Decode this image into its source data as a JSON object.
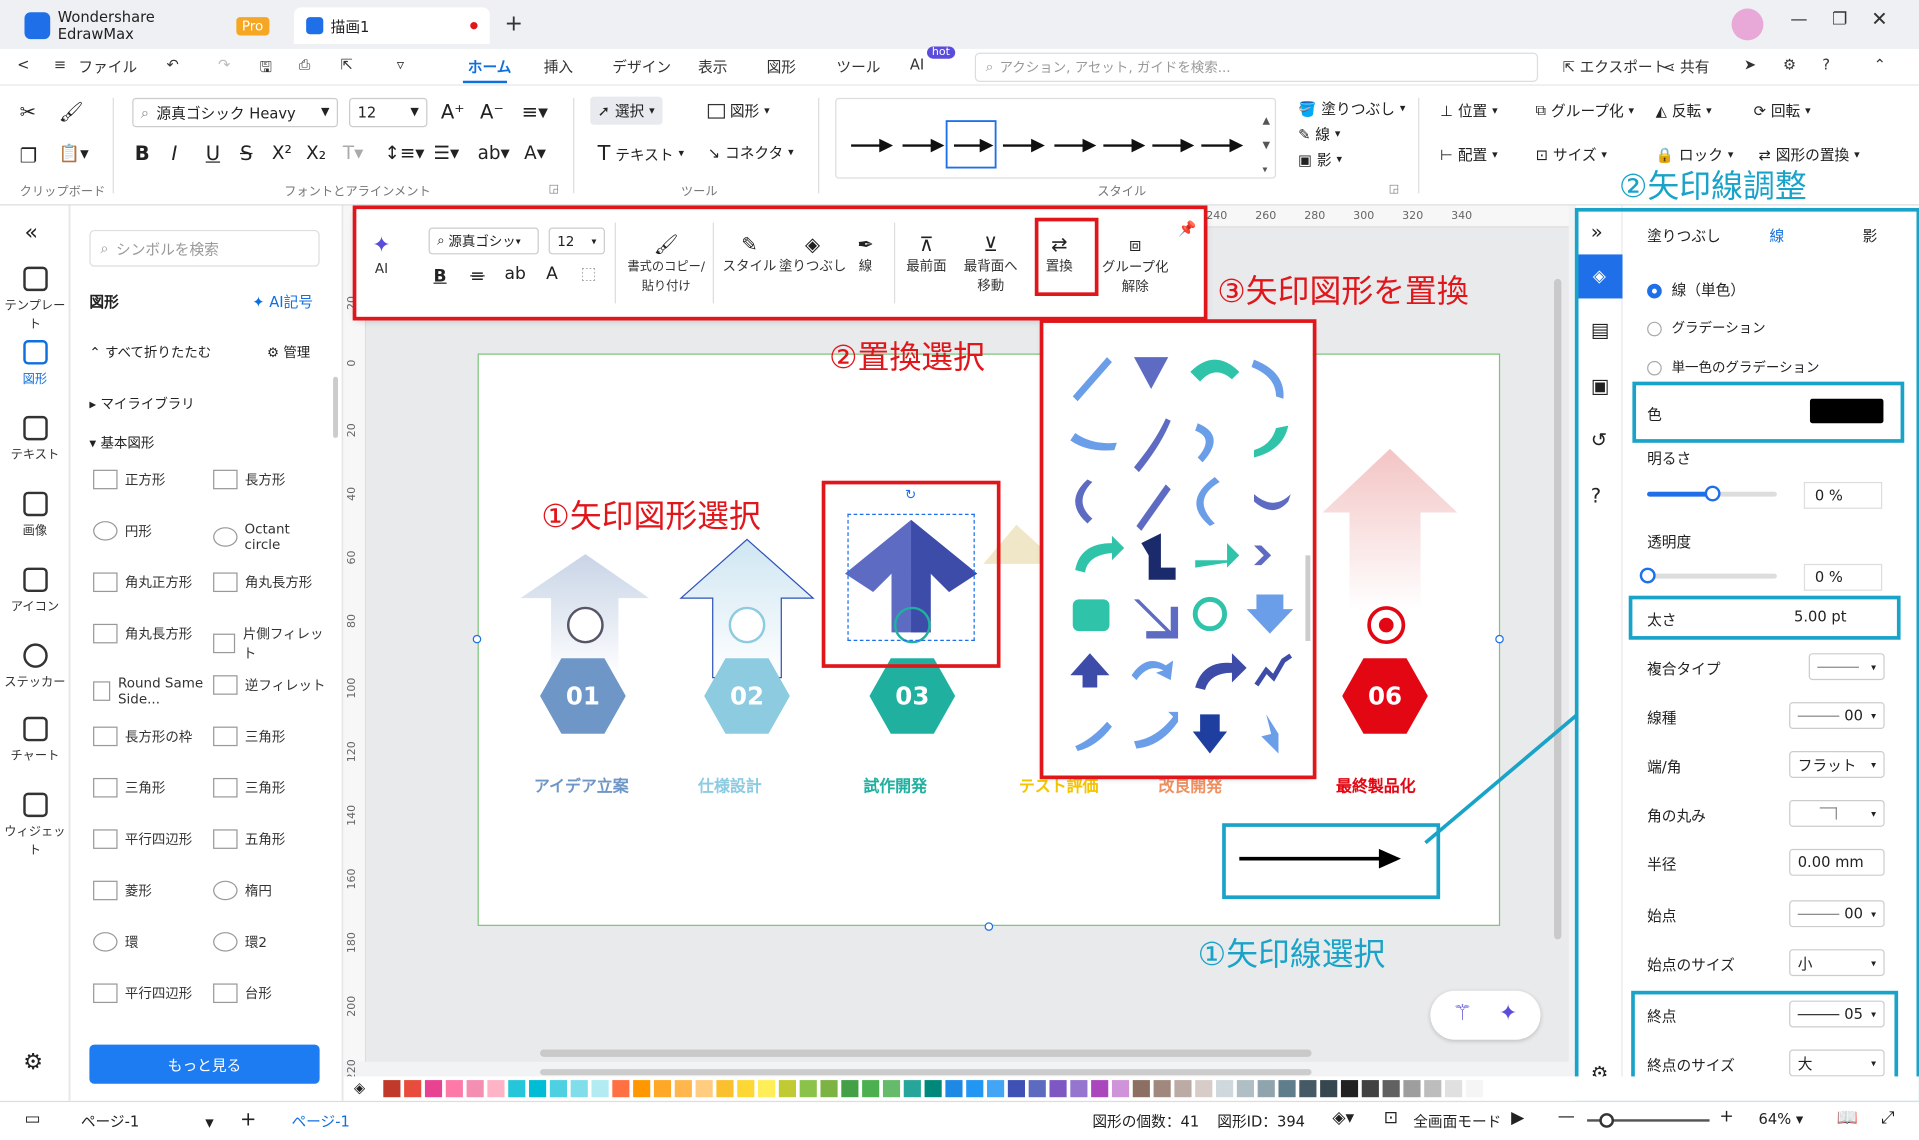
{
  "app": {
    "title": "Wondershare EdrawMax",
    "badge": "Pro",
    "doc_tab": "描画1"
  },
  "menubar": {
    "file": "ファイル",
    "tabs": [
      "ホーム",
      "挿入",
      "デザイン",
      "表示",
      "図形",
      "ツール",
      "AI"
    ],
    "ai_badge": "hot",
    "search_placeholder": "アクション, アセット, ガイドを検索...",
    "export": "エクスポート",
    "share": "共有"
  },
  "ribbon": {
    "font_name": "源真ゴシック Heavy",
    "font_size": "12",
    "select": "選択",
    "shape": "図形",
    "text": "テキスト",
    "connector": "コネクタ",
    "fill": "塗りつぶし",
    "line": "線",
    "shadow": "影",
    "position": "位置",
    "group": "グループ化",
    "flip": "反転",
    "rotate": "回転",
    "align": "配置",
    "size": "サイズ",
    "lock": "ロック",
    "replace_shape": "図形の置換",
    "groups": {
      "clipboard": "クリップボード",
      "font": "フォントとアラインメント",
      "tools": "ツール",
      "style": "スタイル"
    }
  },
  "leftrail": [
    "テンプレート",
    "図形",
    "テキスト",
    "画像",
    "アイコン",
    "ステッカー",
    "チャート",
    "ウィジェット"
  ],
  "library": {
    "search_placeholder": "シンボルを検索",
    "header": "図形",
    "ai_label": "AI記号",
    "collapse_all": "すべて折りたたむ",
    "manage": "管理",
    "my_library": "マイライブラリ",
    "basic_shapes": "基本図形",
    "shapes": [
      [
        "正方形",
        "長方形"
      ],
      [
        "円形",
        "Octant circle"
      ],
      [
        "角丸正方形",
        "角丸長方形"
      ],
      [
        "角丸長方形",
        "片側フィレット"
      ],
      [
        "Round Same Side...",
        "逆フィレット"
      ],
      [
        "長方形の枠",
        "三角形"
      ],
      [
        "三角形",
        "三角形"
      ],
      [
        "平行四辺形",
        "五角形"
      ],
      [
        "菱形",
        "楕円"
      ],
      [
        "環",
        "環2"
      ],
      [
        "平行四辺形",
        "台形"
      ]
    ],
    "more_button": "もっと見る"
  },
  "floating_toolbar": {
    "ai": "AI",
    "font": "源真ゴシッ",
    "size": "12",
    "format_copy": "書式のコピー/貼り付け",
    "style": "スタイル",
    "fill": "塗りつぶし",
    "line": "線",
    "front": "最前面",
    "back": "最背面へ移動",
    "replace": "置換",
    "ungroup": "グループ化解除"
  },
  "ruler": [
    "240",
    "260",
    "280",
    "300",
    "320",
    "340"
  ],
  "vruler": [
    "20",
    "0",
    "20",
    "40",
    "60",
    "80",
    "100",
    "120",
    "140",
    "160",
    "180",
    "200",
    "220"
  ],
  "steps": [
    {
      "num": "01",
      "label": "アイデア立案",
      "color": "#6e96c6",
      "labelcolor": "#6e96c6"
    },
    {
      "num": "02",
      "label": "仕様設計",
      "color": "#8ccbe0",
      "labelcolor": "#8ccbe0"
    },
    {
      "num": "03",
      "label": "試作開発",
      "color": "#1fb0a0",
      "labelcolor": "#1fb0a0"
    },
    {
      "num": "",
      "label": "テスト評価",
      "color": "#f5c400",
      "labelcolor": "#f5c400"
    },
    {
      "num": "",
      "label": "改良開発",
      "color": "#f09060",
      "labelcolor": "#f09060"
    },
    {
      "num": "06",
      "label": "最終製品化",
      "color": "#e30613",
      "labelcolor": "#e30613"
    }
  ],
  "annotations": {
    "red1": "①矢印図形選択",
    "red2": "②置換選択",
    "red3": "③矢印図形を置換",
    "blue1": "①矢印線選択",
    "blue2": "②矢印線調整"
  },
  "rightpanel": {
    "tabs": [
      "塗りつぶし",
      "線",
      "影"
    ],
    "line_options": [
      "線（単色）",
      "グラデーション",
      "単一色のグラデーション"
    ],
    "color_label": "色",
    "brightness": "明るさ",
    "brightness_val": "0 %",
    "brightness_level": 0.5,
    "transparency": "透明度",
    "transparency_val": "0 %",
    "transparency_level": 0,
    "width": "太さ",
    "width_val": "5.00 pt",
    "compound": "複合タイプ",
    "dash": "線種",
    "dash_val": "00",
    "cap": "端/角",
    "cap_val": "フラット",
    "corner": "角の丸み",
    "radius": "半径",
    "radius_val": "0.00 mm",
    "start": "始点",
    "start_val": "00",
    "start_size": "始点のサイズ",
    "start_size_val": "小",
    "end": "終点",
    "end_val": "05",
    "end_size": "終点のサイズ",
    "end_size_val": "大"
  },
  "status": {
    "page_select": "ページ-1",
    "page_tab": "ページ-1",
    "shape_count": "図形の個数：41",
    "shape_id": "図形ID：394",
    "fullscreen": "全画面モード",
    "zoom": "64%"
  },
  "colors": {
    "accent": "#0f6fde",
    "red": "#e0161b",
    "blue": "#1aa3c8"
  }
}
